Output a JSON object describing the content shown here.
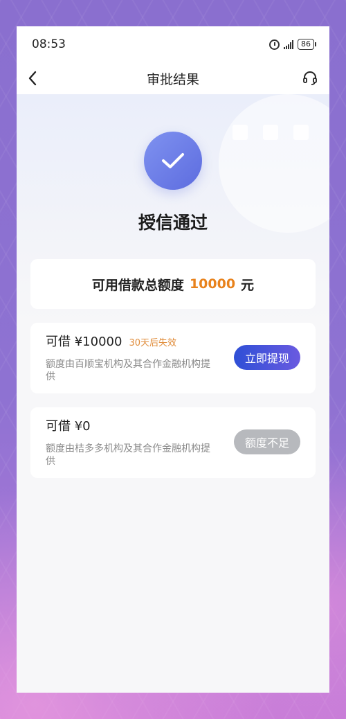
{
  "status_bar": {
    "time": "08:53",
    "battery": "86"
  },
  "nav": {
    "title": "审批结果"
  },
  "result": {
    "title": "授信通过"
  },
  "total": {
    "prefix": "可用借款总额度",
    "amount": "10000",
    "unit": "元"
  },
  "loans": [
    {
      "label": "可借 ¥10000",
      "expire": "30天后失效",
      "desc": "额度由百顺宝机构及其合作金融机构提供",
      "button": "立即提现"
    },
    {
      "label": "可借 ¥0",
      "desc": "额度由桔多多机构及其合作金融机构提供",
      "button": "额度不足"
    }
  ]
}
